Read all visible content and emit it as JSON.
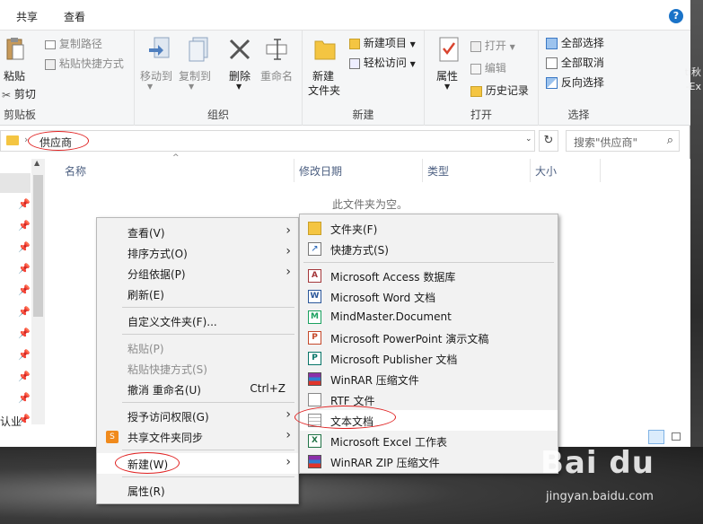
{
  "tabs": [
    "共享",
    "查看"
  ],
  "ribbon": {
    "clipboard": {
      "label": "剪贴板",
      "paste": "粘贴",
      "cut": "剪切",
      "copy_path": "复制路径",
      "paste_shortcut": "粘贴快捷方式"
    },
    "organize": {
      "label": "组织",
      "move_to": "移动到",
      "copy_to": "复制到",
      "delete": "删除",
      "rename": "重命名"
    },
    "new": {
      "label": "新建",
      "new_folder_line1": "新建",
      "new_folder_line2": "文件夹",
      "new_item": "新建项目",
      "easy_access": "轻松访问"
    },
    "open": {
      "label": "打开",
      "properties": "属性",
      "open": "打开",
      "edit": "编辑",
      "history": "历史记录"
    },
    "select": {
      "label": "选择",
      "select_all": "全部选择",
      "select_none": "全部取消",
      "invert": "反向选择"
    }
  },
  "address": {
    "path": "供应商",
    "search_placeholder": "搜索\"供应商\""
  },
  "columns": [
    "名称",
    "修改日期",
    "类型",
    "大小"
  ],
  "empty_message": "此文件夹为空。",
  "nav_label": "认业",
  "context_menu": [
    {
      "label": "查看(V)",
      "submenu": true
    },
    {
      "label": "排序方式(O)",
      "submenu": true
    },
    {
      "label": "分组依据(P)",
      "submenu": true
    },
    {
      "label": "刷新(E)"
    },
    {
      "label": "自定义文件夹(F)..."
    },
    {
      "label": "粘贴(P)",
      "disabled": true
    },
    {
      "label": "粘贴快捷方式(S)",
      "disabled": true
    },
    {
      "label": "撤消 重命名(U)",
      "shortcut": "Ctrl+Z"
    },
    {
      "label": "授予访问权限(G)",
      "submenu": true
    },
    {
      "label": "共享文件夹同步",
      "submenu": true
    },
    {
      "label": "新建(W)",
      "submenu": true
    },
    {
      "label": "属性(R)"
    }
  ],
  "new_submenu": [
    {
      "label": "文件夹(F)",
      "icon": "folder-icon"
    },
    {
      "label": "快捷方式(S)",
      "icon": "shortcut-icon"
    },
    {
      "label": "Microsoft Access 数据库",
      "icon": "access-icon"
    },
    {
      "label": "Microsoft Word 文档",
      "icon": "word-icon"
    },
    {
      "label": "MindMaster.Document",
      "icon": "mindmaster-icon"
    },
    {
      "label": "Microsoft PowerPoint 演示文稿",
      "icon": "powerpoint-icon"
    },
    {
      "label": "Microsoft Publisher 文档",
      "icon": "publisher-icon"
    },
    {
      "label": "WinRAR 压缩文件",
      "icon": "winrar-icon"
    },
    {
      "label": "RTF 文件",
      "icon": "rtf-icon"
    },
    {
      "label": "文本文档",
      "icon": "text-document-icon"
    },
    {
      "label": "Microsoft Excel 工作表",
      "icon": "excel-icon"
    },
    {
      "label": "WinRAR ZIP 压缩文件",
      "icon": "winrar-zip-icon"
    }
  ],
  "watermark": {
    "logo": "Bai du",
    "url": "jingyan.baidu.com"
  },
  "colors": {
    "accent": "#1a73c8",
    "annotation_red": "#e02020"
  }
}
